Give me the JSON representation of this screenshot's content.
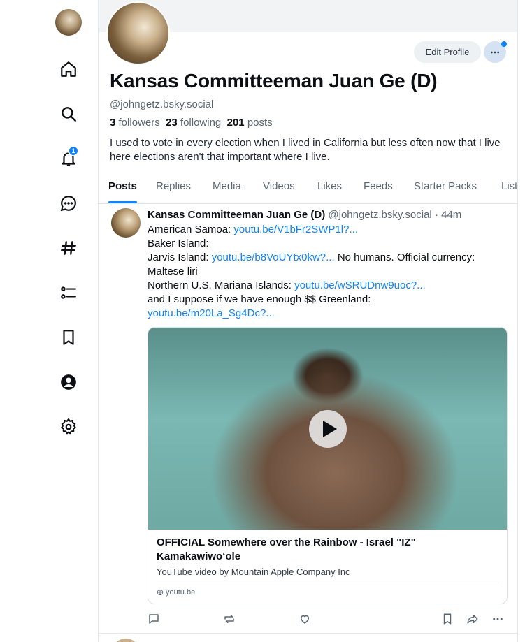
{
  "nav": {
    "items": [
      {
        "name": "home"
      },
      {
        "name": "search"
      },
      {
        "name": "notifications",
        "badge": "1"
      },
      {
        "name": "chat"
      },
      {
        "name": "feeds"
      },
      {
        "name": "lists"
      },
      {
        "name": "saved"
      },
      {
        "name": "profile"
      },
      {
        "name": "settings"
      }
    ]
  },
  "profile": {
    "display_name": "Kansas Committeeman Juan Ge (D)",
    "handle": "@johngetz.bsky.social",
    "followers_count": "3",
    "followers_label": "followers",
    "following_count": "23",
    "following_label": "following",
    "posts_count": "201",
    "posts_label": "posts",
    "bio": "I used to vote in every election when I lived in California but less often now that I live here elections aren't that important where I live.",
    "edit_label": "Edit Profile"
  },
  "tabs": [
    "Posts",
    "Replies",
    "Media",
    "Videos",
    "Likes",
    "Feeds",
    "Starter Packs",
    "Lists"
  ],
  "post": {
    "author": "Kansas Committeeman Juan Ge (D)",
    "handle": "@johngetz.bsky.social",
    "time": "44m",
    "lines": {
      "l1_text": "American Samoa: ",
      "l1_link": "youtu.be/V1bFr2SWP1l?...",
      "l2_text": "Baker Island:",
      "l3_text": "Jarvis Island: ",
      "l3_link": "youtu.be/b8VoUYtx0kw?...",
      "l3_tail": " No humans. Official currency: Maltese liri",
      "l4_text": "Northern U.S. Mariana Islands: ",
      "l4_link": "youtu.be/wSRUDnw9uoc?...",
      "l5_text": "and I suppose if we have enough $$ Greenland:",
      "l6_link": "youtu.be/m20La_Sg4Dc?..."
    },
    "embed": {
      "title": "OFFICIAL Somewhere over the Rainbow - Israel \"IZ\" Kamakawiwoʻole",
      "description": "YouTube video by Mountain Apple Company Inc",
      "domain": "youtu.be"
    }
  },
  "colors": {
    "accent": "#1083fe",
    "muted": "#5b6673",
    "border": "#e4e8ed"
  }
}
